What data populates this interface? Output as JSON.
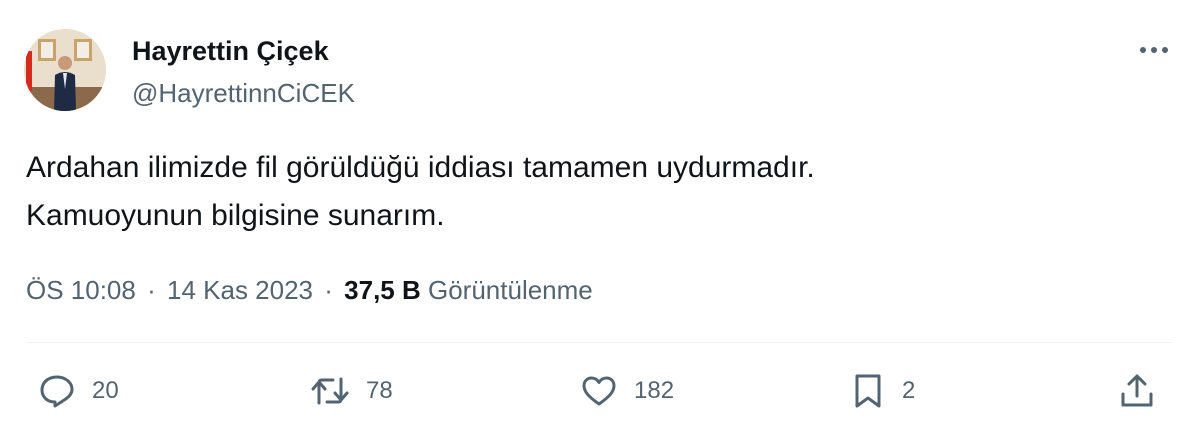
{
  "author": {
    "name": "Hayrettin Çiçek",
    "handle": "@HayrettinnCiCEK"
  },
  "tweet": {
    "lines": [
      "Ardahan ilimizde fil görüldüğü iddiası tamamen uydurmadır.",
      "Kamuoyunun bilgisine sunarım."
    ]
  },
  "meta": {
    "time": "ÖS 10:08",
    "separator": "·",
    "date": "14 Kas 2023",
    "views_count": "37,5 B",
    "views_label": "Görüntülenme"
  },
  "actions": {
    "replies": "20",
    "retweets": "78",
    "likes": "182",
    "bookmarks": "2"
  },
  "icons": {
    "more": "more-dots-icon",
    "reply": "reply-bubble-icon",
    "retweet": "retweet-icon",
    "like": "heart-icon",
    "bookmark": "bookmark-icon",
    "share": "share-upload-icon"
  },
  "colors": {
    "text": "#0f1419",
    "secondary": "#536471",
    "divider": "#eff3f4"
  }
}
